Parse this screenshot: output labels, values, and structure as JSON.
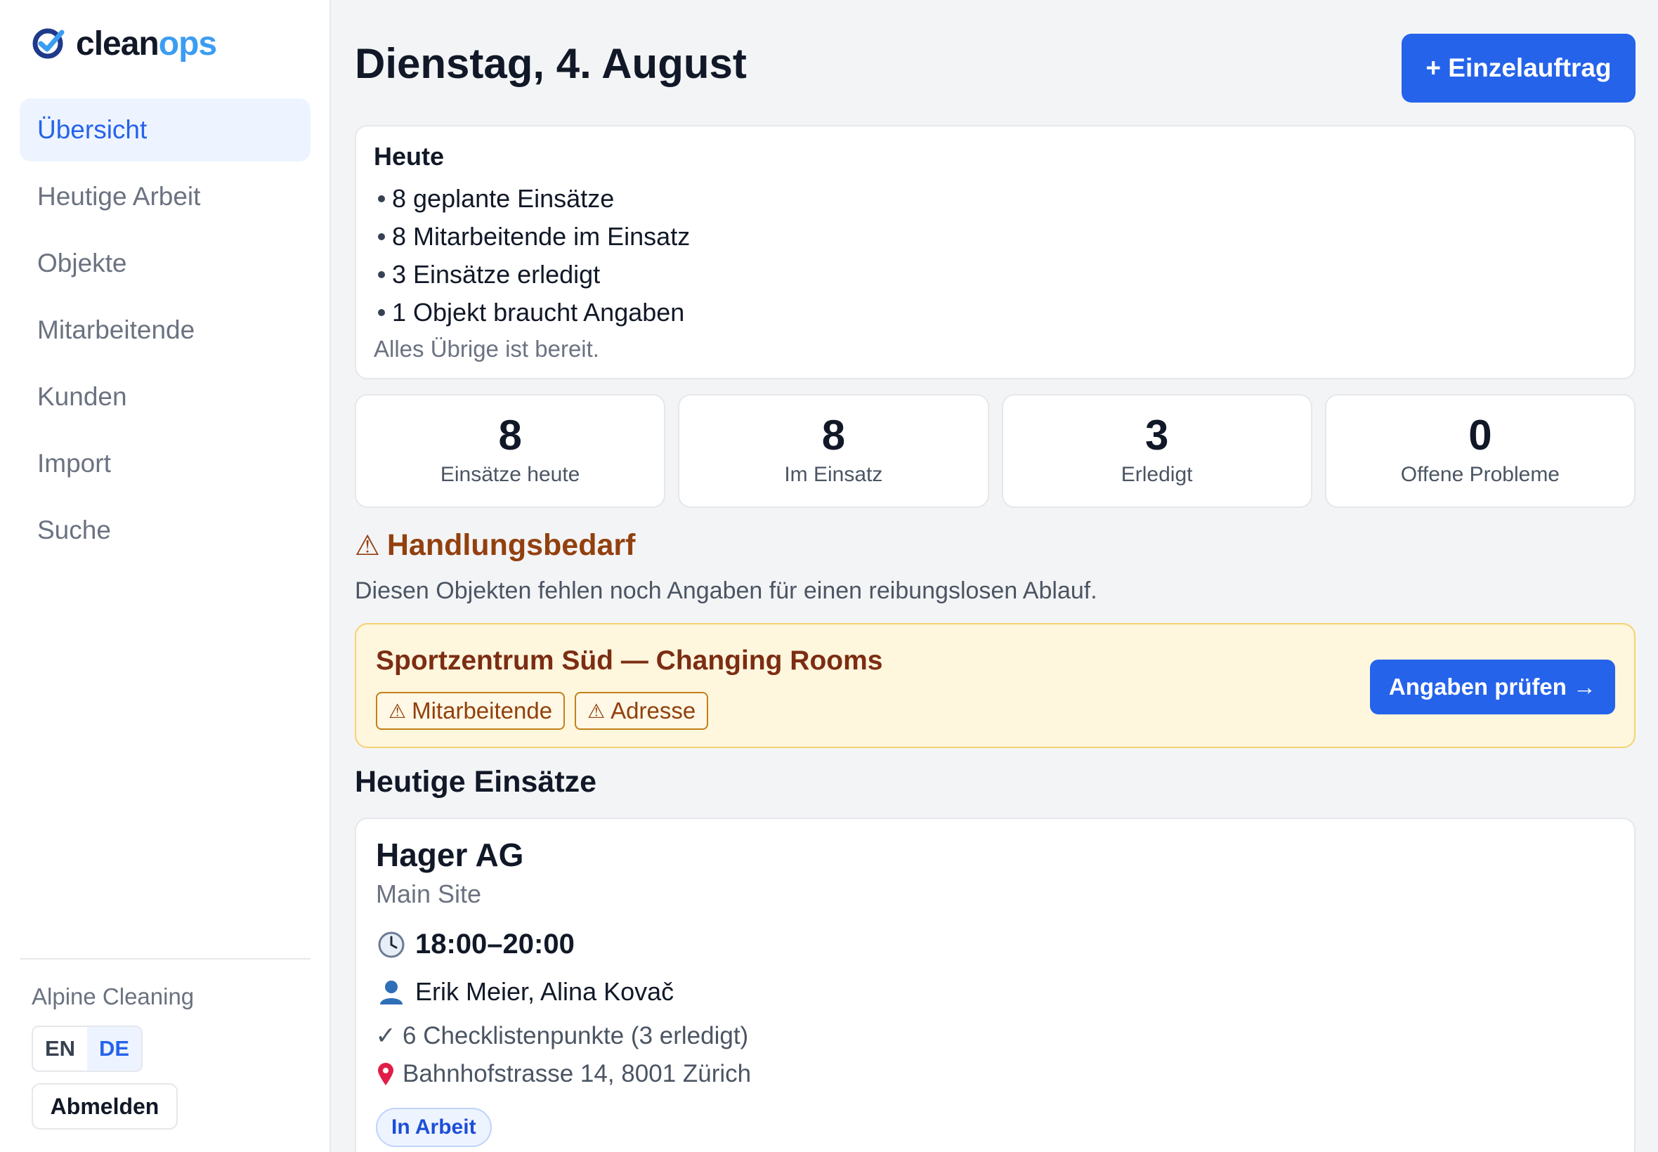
{
  "brand": {
    "name_part1": "clean",
    "name_part2": "ops",
    "accent_color": "#3b9df2"
  },
  "sidebar": {
    "items": [
      {
        "label": "Übersicht",
        "active": true
      },
      {
        "label": "Heutige Arbeit"
      },
      {
        "label": "Objekte"
      },
      {
        "label": "Mitarbeitende"
      },
      {
        "label": "Kunden"
      },
      {
        "label": "Import"
      },
      {
        "label": "Suche"
      }
    ],
    "org_name": "Alpine Cleaning",
    "languages": [
      "EN",
      "DE"
    ],
    "active_language": "DE",
    "logout_label": "Abmelden"
  },
  "header": {
    "title": "Dienstag, 4. August",
    "primary_action": "+ Einzelauftrag"
  },
  "today": {
    "title": "Heute",
    "items": [
      "8 geplante Einsätze",
      "8 Mitarbeitende im Einsatz",
      "3 Einsätze erledigt",
      "1 Objekt braucht Angaben"
    ],
    "note": "Alles Übrige ist bereit."
  },
  "stats": [
    {
      "value": "8",
      "label": "Einsätze heute"
    },
    {
      "value": "8",
      "label": "Im Einsatz"
    },
    {
      "value": "3",
      "label": "Erledigt"
    },
    {
      "value": "0",
      "label": "Offene Probleme"
    }
  ],
  "action_needed": {
    "title": "Handlungsbedarf",
    "description": "Diesen Objekten fehlen noch Angaben für einen reibungslosen Ablauf.",
    "alert": {
      "title": "Sportzentrum Süd — Changing Rooms",
      "tags": [
        "Mitarbeitende",
        "Adresse"
      ],
      "button": "Angaben prüfen →"
    }
  },
  "jobs_section": {
    "title": "Heutige Einsätze",
    "jobs": [
      {
        "client": "Hager AG",
        "site": "Main Site",
        "time": "18:00–20:00",
        "staff": "Erik Meier, Alina Kovač",
        "checklist": "6 Checklistenpunkte (3 erledigt)",
        "address": "Bahnhofstrasse 14, 8001 Zürich",
        "status": "In Arbeit"
      }
    ]
  },
  "icons": {
    "logo": "checkmark-badge-icon",
    "warning": "warning-triangle-icon",
    "clock": "clock-icon",
    "person": "person-icon",
    "check": "checkmark-icon",
    "pin": "map-pin-icon"
  },
  "colors": {
    "primary": "#2563eb",
    "warning_text": "#92400e",
    "alert_bg": "#fef6dd"
  }
}
